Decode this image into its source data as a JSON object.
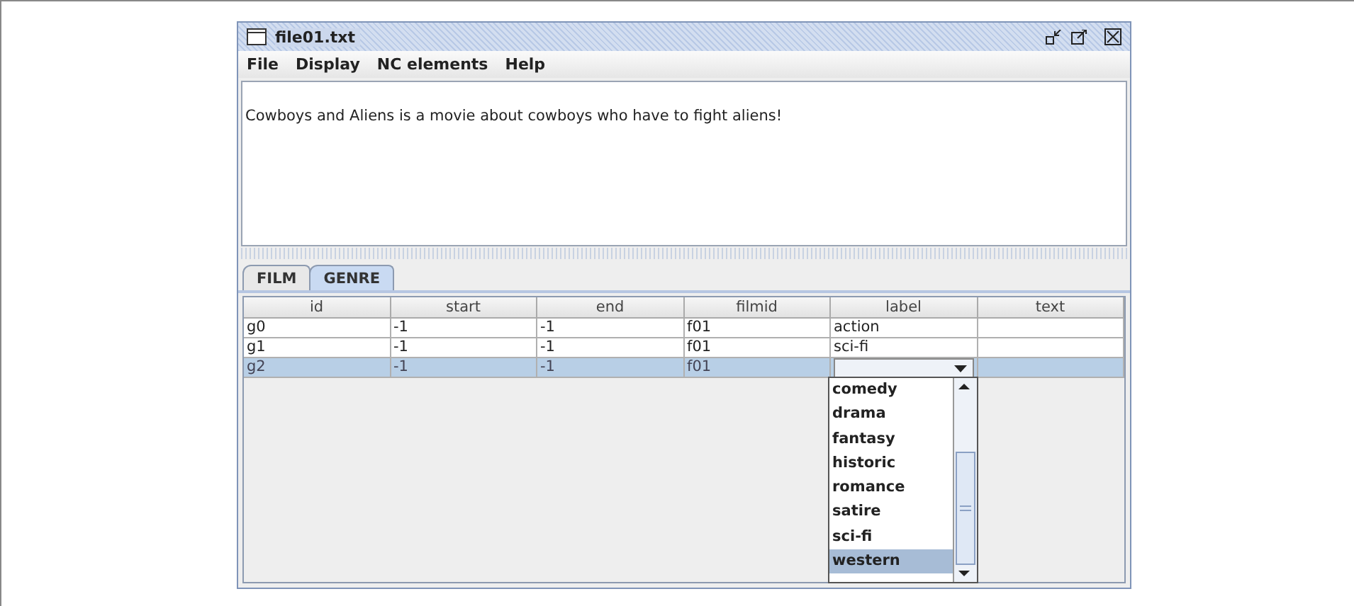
{
  "window": {
    "title": "file01.txt"
  },
  "menu": [
    "File",
    "Display",
    "NC elements",
    "Help"
  ],
  "text_area": {
    "value": "Cowboys and Aliens is a movie about cowboys who have to fight aliens!"
  },
  "tabs": [
    {
      "label": "FILM",
      "selected": false
    },
    {
      "label": "GENRE",
      "selected": true
    }
  ],
  "table": {
    "columns": [
      "id",
      "start",
      "end",
      "filmid",
      "label",
      "text"
    ],
    "rows": [
      {
        "selected": false,
        "cells": [
          "g0",
          "-1",
          "-1",
          "f01",
          "action",
          ""
        ]
      },
      {
        "selected": false,
        "cells": [
          "g1",
          "-1",
          "-1",
          "f01",
          "sci-fi",
          ""
        ]
      },
      {
        "selected": true,
        "cells": [
          "g2",
          "-1",
          "-1",
          "f01",
          "",
          ""
        ]
      }
    ]
  },
  "dropdown": {
    "options": [
      {
        "label": "comedy",
        "selected": false
      },
      {
        "label": "drama",
        "selected": false
      },
      {
        "label": "fantasy",
        "selected": false
      },
      {
        "label": "historic",
        "selected": false
      },
      {
        "label": "romance",
        "selected": false
      },
      {
        "label": "satire",
        "selected": false
      },
      {
        "label": "sci-fi",
        "selected": false
      },
      {
        "label": "western",
        "selected": true
      }
    ]
  }
}
